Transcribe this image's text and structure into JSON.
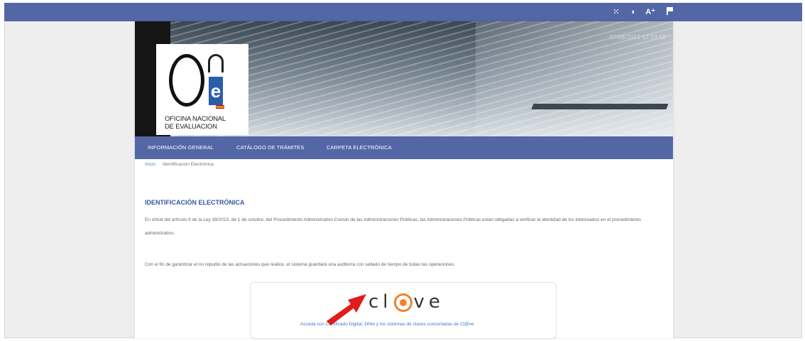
{
  "topbar": {
    "icons": [
      "sitemap-icon",
      "contrast-icon",
      "text-size-icon",
      "flag-icon"
    ],
    "icon_glyphs": {
      "contrast": "◑",
      "text_size": "A⁺"
    }
  },
  "header": {
    "date": "07/08/2023 12:13:59",
    "logo_line1": "OFICINA NACIONAL",
    "logo_line2": "DE EVALUACION"
  },
  "nav": {
    "items": [
      {
        "label": "INFORMACIÓN GENERAL"
      },
      {
        "label": "CATÁLOGO DE TRÁMITES"
      },
      {
        "label": "CARPETA ELECTRÓNICA"
      }
    ]
  },
  "breadcrumb": {
    "home": "Inicio",
    "current": "Identificación Electrónica"
  },
  "main": {
    "title": "IDENTIFICACIÓN ELECTRÓNICA",
    "para1": "En virtud del artículo 9 de la Ley 39/2015, de 1 de octubre, del Procedimiento Administrativo Común de las Administraciones Públicas, las Administraciones Públicas están obligadas a verificar la identidad de los interesados en el procedimiento administrativo.",
    "para2": "Con el fin de garantizar el no repudio de las actuaciones que realice, el sistema guardará una auditoría con sellado de tiempo de todas las operaciones."
  },
  "clave": {
    "logo_left": "cl",
    "logo_right": "ve",
    "link": "Acceda con Certificado Digital, DNIe y los sistemas de claves concertadas de Cl@ve"
  },
  "colors": {
    "bar": "#5366a6",
    "title": "#3b56a0",
    "link": "#3d7cc9",
    "arrow": "#e21b1b",
    "clave_accent": "#f0822d"
  }
}
